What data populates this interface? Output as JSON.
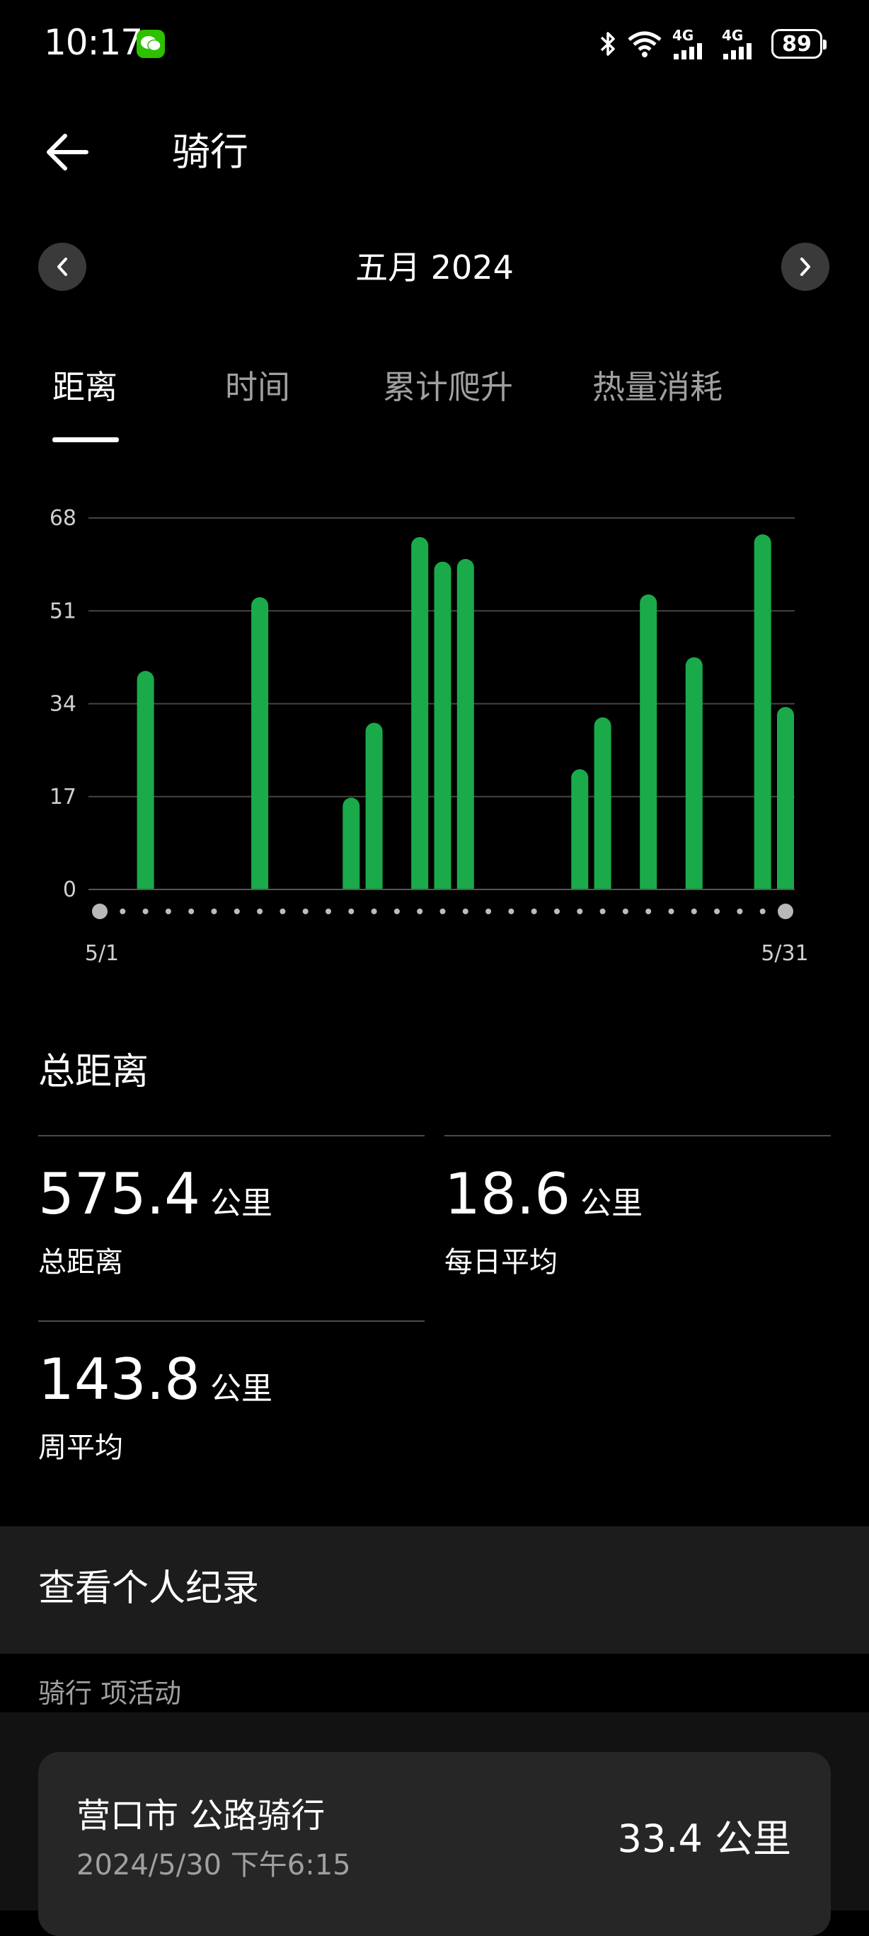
{
  "status_bar": {
    "time": "10:17",
    "network_1": "4G",
    "network_2": "4G",
    "battery": "89"
  },
  "header": {
    "title": "骑行"
  },
  "month_nav": {
    "label": "五月 2024"
  },
  "tabs": [
    {
      "label": "距离",
      "active": true
    },
    {
      "label": "时间",
      "active": false
    },
    {
      "label": "累计爬升",
      "active": false
    },
    {
      "label": "热量消耗",
      "active": false
    }
  ],
  "chart_data": {
    "type": "bar",
    "x_start_label": "5/1",
    "x_end_label": "5/31",
    "yticks": [
      "0",
      "17",
      "34",
      "51",
      "68"
    ],
    "ylim": [
      0,
      68
    ],
    "grid": true,
    "bar_color": "#1aaa4a",
    "days": [
      1,
      2,
      3,
      4,
      5,
      6,
      7,
      8,
      9,
      10,
      11,
      12,
      13,
      14,
      15,
      16,
      17,
      18,
      19,
      20,
      21,
      22,
      23,
      24,
      25,
      26,
      27,
      28,
      29,
      30,
      31
    ],
    "values": [
      0,
      0,
      40,
      0,
      0,
      0,
      0,
      53.5,
      0,
      0,
      0,
      16.8,
      30.5,
      0,
      64.5,
      60,
      60.5,
      0,
      0,
      0,
      0,
      22,
      31.5,
      0,
      54,
      0,
      42.5,
      0,
      0,
      65,
      33.4
    ]
  },
  "stats": {
    "title": "总距离",
    "total": {
      "value": "575.4",
      "unit": "公里",
      "label": "总距离"
    },
    "daily": {
      "value": "18.6",
      "unit": "公里",
      "label": "每日平均"
    },
    "weekly": {
      "value": "143.8",
      "unit": "公里",
      "label": "周平均"
    }
  },
  "records": {
    "link_label": "查看个人纪录"
  },
  "activities": {
    "header": "骑行 项活动",
    "items": [
      {
        "title": "营口市 公路骑行",
        "time": "2024/5/30 下午6:15",
        "distance": "33.4 公里"
      }
    ]
  }
}
